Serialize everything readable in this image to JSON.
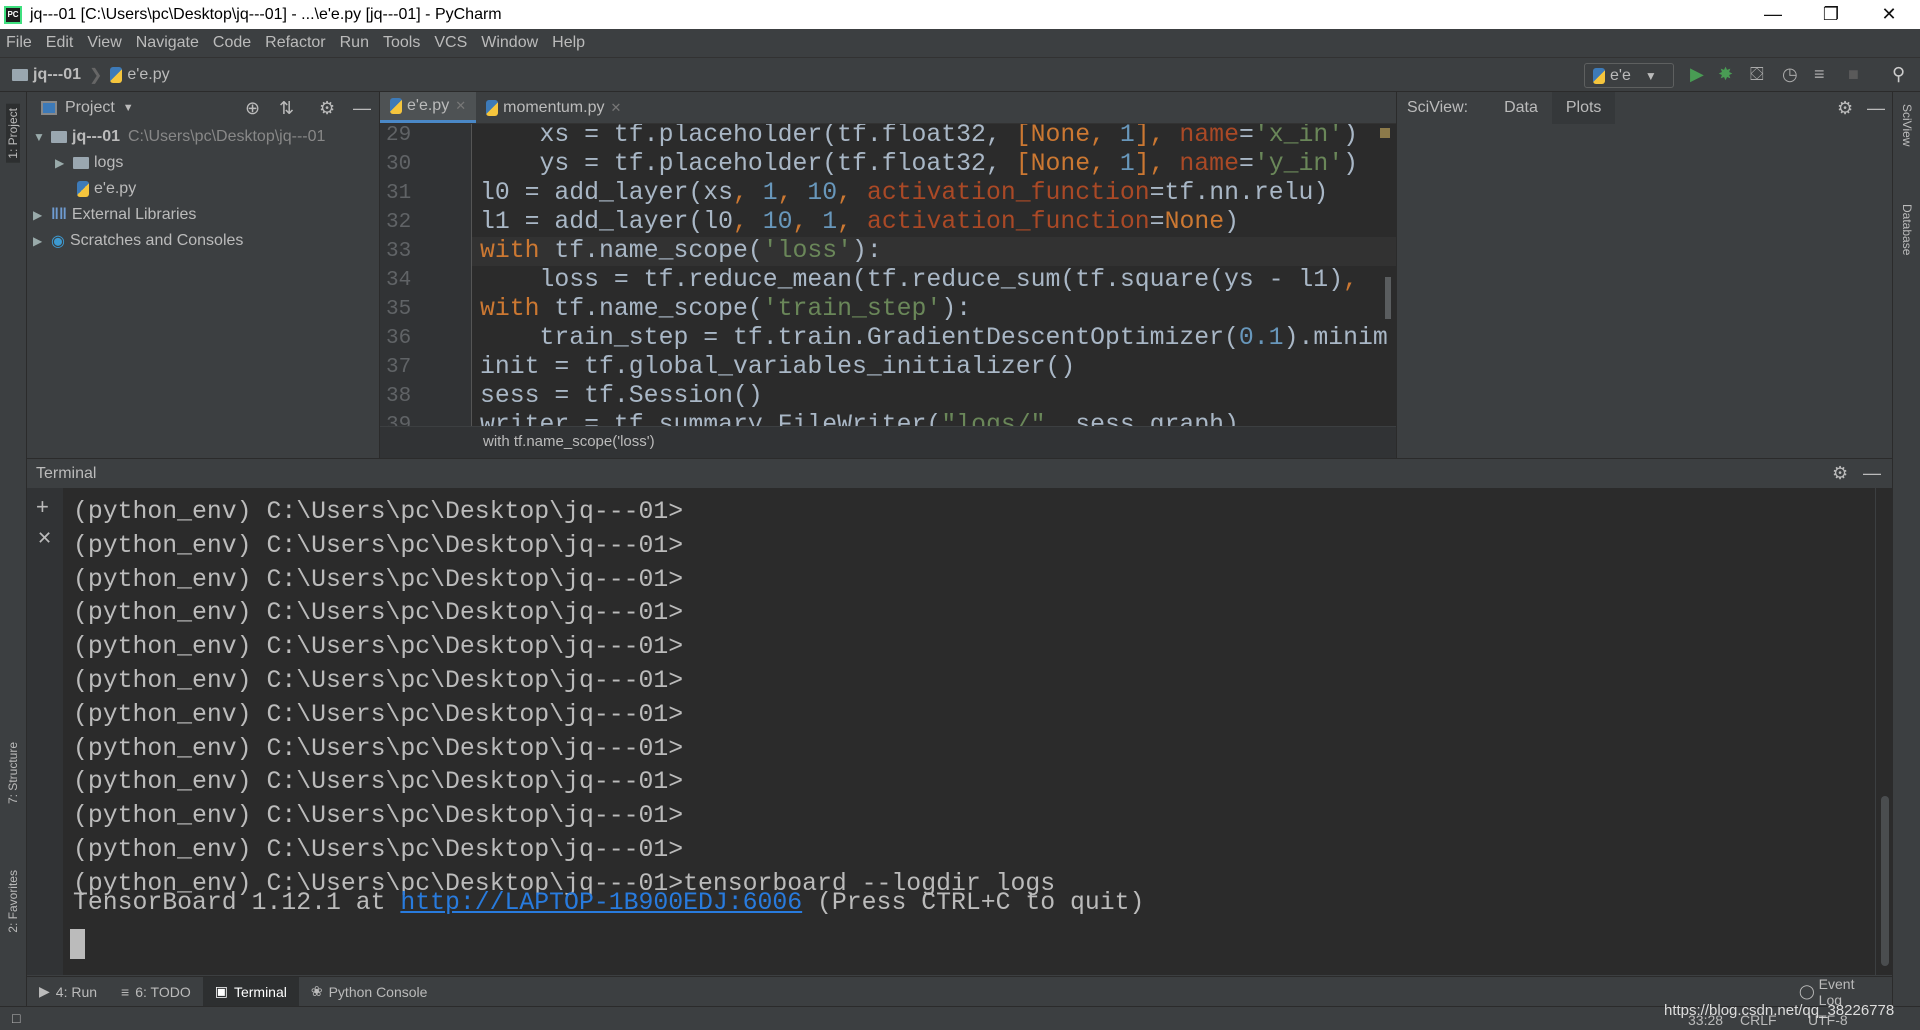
{
  "window": {
    "title": "jq---01 [C:\\Users\\pc\\Desktop\\jq---01] - ...\\e'e.py [jq---01] - PyCharm",
    "app_icon": "PC"
  },
  "menu": [
    "File",
    "Edit",
    "View",
    "Navigate",
    "Code",
    "Refactor",
    "Run",
    "Tools",
    "VCS",
    "Window",
    "Help"
  ],
  "navbar": {
    "project": "jq---01",
    "file": "e'e.py",
    "run_config": "e'e"
  },
  "left_stripe": {
    "project": "1: Project",
    "structure": "7: Structure",
    "favorites": "2: Favorites"
  },
  "right_stripe": {
    "sciview": "SciView",
    "database": "Database"
  },
  "project_panel": {
    "title": "Project",
    "root": {
      "name": "jq---01",
      "path": "C:\\Users\\pc\\Desktop\\jq---01"
    },
    "items": [
      {
        "label": "logs"
      },
      {
        "label": "e'e.py"
      },
      {
        "label": "External Libraries"
      },
      {
        "label": "Scratches and Consoles"
      }
    ]
  },
  "editor": {
    "tabs": [
      {
        "label": "e'e.py",
        "active": true
      },
      {
        "label": "momentum.py",
        "active": false
      }
    ],
    "highlighted_line": 33,
    "lines": [
      {
        "n": "29",
        "tokens": [
          [
            "    xs = tf.placeholder(tf.float32, ",
            ""
          ],
          [
            "[None",
            "kw"
          ],
          [
            ", ",
            "cm"
          ],
          [
            "1",
            "nu"
          ],
          [
            "], ",
            "kw"
          ],
          [
            "name",
            "pa"
          ],
          [
            "=",
            ""
          ],
          [
            "'x_in'",
            "st"
          ],
          [
            ")",
            ""
          ]
        ]
      },
      {
        "n": "30",
        "tokens": [
          [
            "    ys = tf.placeholder(tf.float32, ",
            ""
          ],
          [
            "[None",
            "kw"
          ],
          [
            ", ",
            "cm"
          ],
          [
            "1",
            "nu"
          ],
          [
            "], ",
            "kw"
          ],
          [
            "name",
            "pa"
          ],
          [
            "=",
            ""
          ],
          [
            "'y_in'",
            "st"
          ],
          [
            ")",
            ""
          ]
        ]
      },
      {
        "n": "31",
        "tokens": [
          [
            "l0 = add_layer(xs",
            ""
          ],
          [
            ", ",
            "cm"
          ],
          [
            "1",
            "nu"
          ],
          [
            ", ",
            "cm"
          ],
          [
            "10",
            "nu"
          ],
          [
            ", ",
            "cm"
          ],
          [
            "activation_function",
            "pa"
          ],
          [
            "=tf.nn.relu)",
            ""
          ]
        ]
      },
      {
        "n": "32",
        "tokens": [
          [
            "l1 = add_layer(l0",
            ""
          ],
          [
            ", ",
            "cm"
          ],
          [
            "10",
            "nu"
          ],
          [
            ", ",
            "cm"
          ],
          [
            "1",
            "nu"
          ],
          [
            ", ",
            "cm"
          ],
          [
            "activation_function",
            "pa"
          ],
          [
            "=",
            ""
          ],
          [
            "None",
            "kw"
          ],
          [
            ")",
            ""
          ]
        ]
      },
      {
        "n": "33",
        "tokens": [
          [
            "with ",
            "kw"
          ],
          [
            "tf.name_scope(",
            ""
          ],
          [
            "'loss'",
            "st"
          ],
          [
            "):",
            ""
          ]
        ]
      },
      {
        "n": "34",
        "tokens": [
          [
            "    loss = tf.reduce_mean(tf.reduce_sum(tf.square(ys - l1)",
            ""
          ],
          [
            ",",
            "cm"
          ]
        ]
      },
      {
        "n": "35",
        "tokens": [
          [
            "with ",
            "kw"
          ],
          [
            "tf.name_scope(",
            ""
          ],
          [
            "'train_step'",
            "st"
          ],
          [
            "):",
            ""
          ]
        ]
      },
      {
        "n": "36",
        "tokens": [
          [
            "    train_step = tf.train.GradientDescentOptimizer(",
            ""
          ],
          [
            "0.1",
            "nu"
          ],
          [
            ").minim",
            ""
          ]
        ]
      },
      {
        "n": "37",
        "tokens": [
          [
            "init = tf.global_variables_initializer()",
            ""
          ]
        ]
      },
      {
        "n": "38",
        "tokens": [
          [
            "sess = tf.Session()",
            ""
          ]
        ]
      },
      {
        "n": "39",
        "tokens": [
          [
            "writer = tf.summary.FileWriter(",
            ""
          ],
          [
            "\"logs/\"",
            "st"
          ],
          [
            ", ",
            "cm"
          ],
          [
            "sess.graph)",
            ""
          ]
        ]
      }
    ],
    "breadcrumb": "with tf.name_scope('loss')"
  },
  "sciview": {
    "label": "SciView:",
    "tabs": [
      "Data",
      "Plots"
    ],
    "active_tab": "Plots"
  },
  "terminal": {
    "title": "Terminal",
    "lines": [
      "(python_env) C:\\Users\\pc\\Desktop\\jq---01>",
      "(python_env) C:\\Users\\pc\\Desktop\\jq---01>",
      "(python_env) C:\\Users\\pc\\Desktop\\jq---01>",
      "(python_env) C:\\Users\\pc\\Desktop\\jq---01>",
      "(python_env) C:\\Users\\pc\\Desktop\\jq---01>",
      "(python_env) C:\\Users\\pc\\Desktop\\jq---01>",
      "(python_env) C:\\Users\\pc\\Desktop\\jq---01>",
      "(python_env) C:\\Users\\pc\\Desktop\\jq---01>",
      "(python_env) C:\\Users\\pc\\Desktop\\jq---01>",
      "(python_env) C:\\Users\\pc\\Desktop\\jq---01>",
      "(python_env) C:\\Users\\pc\\Desktop\\jq---01>",
      "(python_env) C:\\Users\\pc\\Desktop\\jq---01>tensorboard --logdir logs"
    ],
    "tb_prefix": "TensorBoard 1.12.1 at ",
    "tb_link": "http://LAPTOP-1B900EDJ:6006",
    "tb_suffix": " (Press CTRL+C to quit)"
  },
  "bottom_tabs": [
    {
      "label": "4: Run"
    },
    {
      "label": "6: TODO"
    },
    {
      "label": "Terminal",
      "active": true
    },
    {
      "label": "Python Console"
    }
  ],
  "event_log": "Event Log",
  "status": {
    "position": "33:28",
    "line_sep": "CRLF",
    "encoding": "UTF-8",
    "watermark": "https://blog.csdn.net/qq_38226778"
  },
  "colors": {
    "keyword": "#cc7832",
    "string": "#6a8759",
    "number": "#6897bb",
    "param": "#aa4926",
    "text": "#a9b7c6",
    "link": "#287bde",
    "run": "#499c54"
  }
}
